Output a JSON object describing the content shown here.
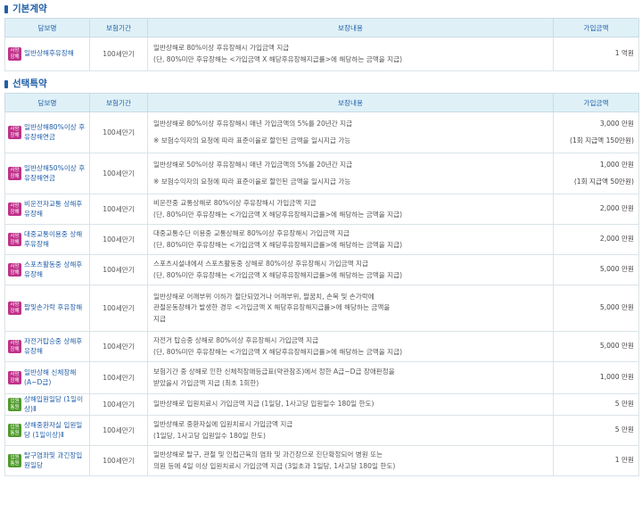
{
  "basic_section": {
    "title": "기본계약",
    "headers": [
      "담보명",
      "보험기간",
      "보장내용",
      "가입금액"
    ],
    "rows": [
      {
        "badge_type": "death",
        "badge_line1": "사망",
        "badge_line2": "장해",
        "name": "일반상해후유장해",
        "period": "100세만기",
        "desc_line1": "일반상해로 80%이상 후유장해시 가입금액 지급",
        "desc_line2": "(단, 80%미만 후유장해는 <가입금액 X 해당후유장해지급률>에 해당하는 금액을 지급)",
        "amount_line1": "1 억원"
      }
    ]
  },
  "optional_section": {
    "title": "선택특약",
    "headers": [
      "담보명",
      "보험기간",
      "보장내용",
      "가입금액"
    ],
    "rows": [
      {
        "badge_type": "death",
        "badge_line1": "사망",
        "badge_line2": "장해",
        "name": "일반상해80%이상 후유장해연금",
        "period": "100세만기",
        "desc_line1": "일반상해로 80%이상 후유장해시 매년 가입금액의 5%를 20년간 지급",
        "desc_note": "※ 보험수익자의 요청에 따라 표준이율로 할인된 금액을 일시지급 가능",
        "amount_line1": "3,000 만원",
        "amount_line2": "(1회 지급액 150만원)"
      },
      {
        "badge_type": "death",
        "badge_line1": "사망",
        "badge_line2": "장해",
        "name": "일반상해50%이상 후유장해연금",
        "period": "100세만기",
        "desc_line1": "일반상해로 50%이상 후유장해시 매년 가입금액의 5%를 20년간 지급",
        "desc_note": "※ 보험수익자의 요청에 따라 표준이율로 할인된 금액을 일시지급 가능",
        "amount_line1": "1,000 만원",
        "amount_line2": "(1회 지급액 50만원)"
      },
      {
        "badge_type": "death",
        "badge_line1": "사망",
        "badge_line2": "장해",
        "name": "비운전자교통 상해후유장해",
        "period": "100세만기",
        "desc_line1": "비운전중 교통상해로 80%이상 후유장해시 가입금액 지급",
        "desc_line2": "(단, 80%미만 후유장해는 <가입금액 X 해당후유장해지급률>에 해당하는 금액을 지급)",
        "amount_line1": "2,000 만원"
      },
      {
        "badge_type": "death",
        "badge_line1": "사망",
        "badge_line2": "장해",
        "name": "대중교통이용중 상해후유장해",
        "period": "100세만기",
        "desc_line1": "대중교통수단 이용중 교통상해로 80%이상 후유장해시 가입금액 지급",
        "desc_line2": "(단, 80%미만 후유장해는 <가입금액 X 해당후유장해지급률>에 해당하는 금액을 지급)",
        "amount_line1": "2,000 만원"
      },
      {
        "badge_type": "death",
        "badge_line1": "사망",
        "badge_line2": "장해",
        "name": "스포츠활동중 상해후유장해",
        "period": "100세만기",
        "desc_line1": "스포츠시설내에서 스포츠활동중 상해로 80%이상 후유장해시 가입금액 지급",
        "desc_line2": "(단, 80%미만 후유장해는 <가입금액 X 해당후유장해지급률>에 해당하는 금액을 지급)",
        "amount_line1": "5,000 만원"
      },
      {
        "badge_type": "death",
        "badge_line1": "사망",
        "badge_line2": "장해",
        "name": "팔및손가락 후유장해",
        "period": "100세만기",
        "desc_line1": "일반상해로 어깨부위 이하가 절단되었거나 어깨부위, 팔꿈치, 손목 및 손가락에",
        "desc_line2": "관절운동장해가 발생한 경우 <가입금액 X 해당후유장해지급률>에 해당하는 금액을",
        "desc_line3": "지급",
        "amount_line1": "5,000 만원"
      },
      {
        "badge_type": "death",
        "badge_line1": "사망",
        "badge_line2": "장해",
        "name": "자전거탑승중 상해후유장해",
        "period": "100세만기",
        "desc_line1": "자전거 탑승중 상해로 80%이상 후유장해시 가입금액 지급",
        "desc_line2": "(단, 80%미만 후유장해는 <가입금액 X 해당후유장해지급률>에 해당하는 금액을 지급)",
        "amount_line1": "5,000 만원"
      },
      {
        "badge_type": "death",
        "badge_line1": "사망",
        "badge_line2": "장해",
        "name": "일반상해 신체장해(A~D급)",
        "period": "100세만기",
        "desc_line1": "보험기간 중 상해로 인한 신체적장애등급표(약관참조)에서 정한 A급~D급 장애판정을",
        "desc_line2": "받았을시 가입금액 지급 (최초 1회한)",
        "amount_line1": "1,000 만원"
      },
      {
        "badge_type": "hosp",
        "badge_line1": "입원",
        "badge_line2": "통원",
        "name": "상해입원일당 (1일이상)Ⅱ",
        "period": "100세만기",
        "desc_line1": "일반상해로 입원치료시 가입금액 지급 (1일당, 1사고당 입원일수 180일 한도)",
        "amount_line1": "5 만원"
      },
      {
        "badge_type": "hosp",
        "badge_line1": "입원",
        "badge_line2": "통원",
        "name": "상해중환자실 입원일당 (1일이상)Ⅱ",
        "period": "100세만기",
        "desc_line1": "일반상해로 중환자실에 입원치료시 가입금액 지급",
        "desc_line2": "(1일당, 1사고당 입원일수 180일 한도)",
        "amount_line1": "5 만원"
      },
      {
        "badge_type": "hosp",
        "badge_line1": "입원",
        "badge_line2": "통원",
        "name": "탈구염좌및 과긴장입원일당",
        "period": "100세만기",
        "desc_line1": "일반상해로 탈구, 관절 및 인접근육의 염좌 및 과긴장으로 진단확정되어 병원 또는",
        "desc_line2": "의원 등에 4일 이상 입원치료시 가입금액 지급 (3일초과 1일당, 1사고당 180일 한도)",
        "amount_line1": "1 만원"
      }
    ]
  }
}
